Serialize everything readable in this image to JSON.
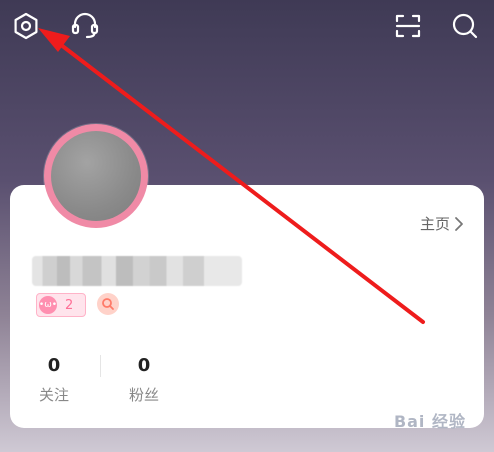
{
  "topbar": {
    "icons": [
      "settings-hexagon-icon",
      "customer-service-headset-icon",
      "scan-icon",
      "search-icon"
    ]
  },
  "profile": {
    "homepage_label": "主页",
    "level": "2",
    "level_face": "•ω•",
    "stats": [
      {
        "value": "0",
        "label": "关注"
      },
      {
        "value": "0",
        "label": "粉丝"
      }
    ]
  },
  "annotation": {
    "color": "#ee1c1c"
  },
  "watermark": "Bai 经验"
}
